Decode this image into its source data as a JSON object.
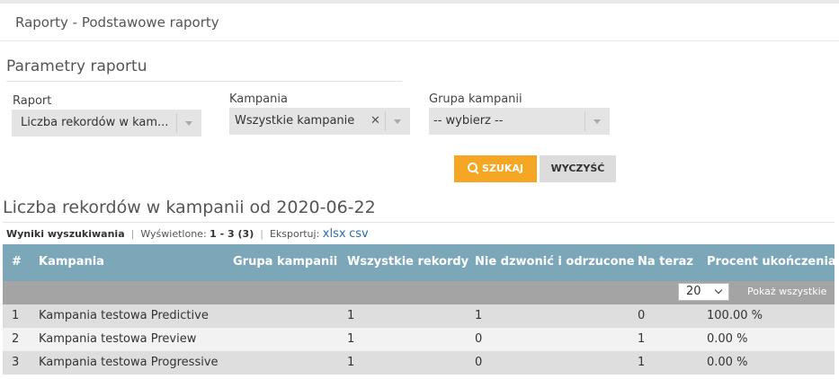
{
  "header": {
    "title": "Raporty - Podstawowe raporty"
  },
  "params": {
    "title": "Parametry raportu",
    "report": {
      "label": "Raport",
      "value": "Liczba rekordów w kam..."
    },
    "campaign": {
      "label": "Kampania",
      "value": "Wszystkie kampanie",
      "clear": "✕"
    },
    "group": {
      "label": "Grupa kampanii",
      "value": "-- wybierz --"
    },
    "search_label": "SZUKAJ",
    "clear_label": "WYCZYŚĆ"
  },
  "report": {
    "title": "Liczba rekordów w kampanii od 2020-06-22",
    "results_label": "Wyniki wyszukiwania",
    "shown_label": "Wyświetlone:",
    "shown_value": "1 - 3 (3)",
    "export_label": "Eksportuj:",
    "export_xlsx": "xlsx",
    "export_csv": "csv"
  },
  "table": {
    "columns": [
      "#",
      "Kampania",
      "Grupa kampanii",
      "Wszystkie rekordy",
      "Nie dzwonić i odrzucone",
      "Na teraz",
      "Procent ukończenia"
    ],
    "page_size": "20",
    "show_all": "Pokaż wszystkie",
    "rows": [
      [
        "1",
        "Kampania testowa Predictive",
        "",
        "1",
        "1",
        "0",
        "100.00 %"
      ],
      [
        "2",
        "Kampania testowa Preview",
        "",
        "1",
        "0",
        "1",
        "0.00 %"
      ],
      [
        "3",
        "Kampania testowa Progressive",
        "",
        "1",
        "0",
        "1",
        "0.00 %"
      ]
    ]
  },
  "colors": {
    "header": "#7ba7b8",
    "search_button": "#f5a623",
    "link": "#2a6db3"
  }
}
